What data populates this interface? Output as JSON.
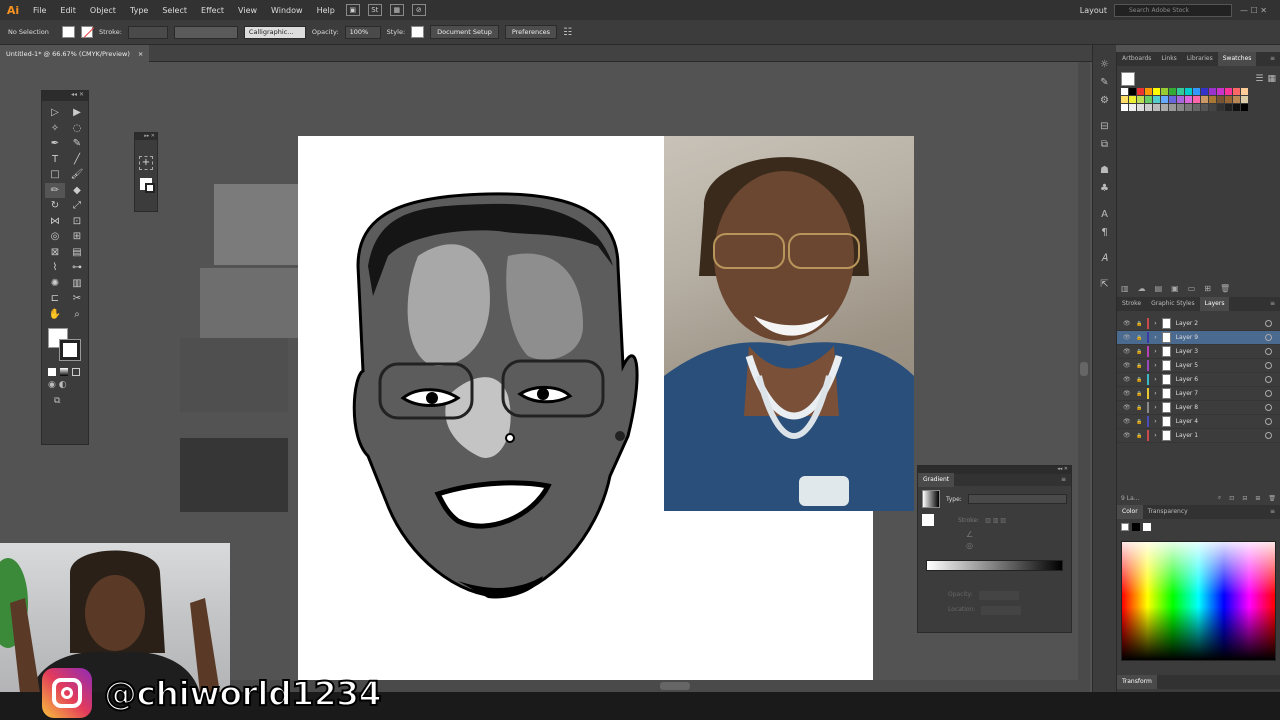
{
  "app": {
    "logo": "Ai"
  },
  "menu": [
    "File",
    "Edit",
    "Object",
    "Type",
    "Select",
    "Effect",
    "View",
    "Window",
    "Help"
  ],
  "menu_right": {
    "workspace": "Layout",
    "search_placeholder": "Search Adobe Stock"
  },
  "control_bar": {
    "selection": "No Selection",
    "stroke_label": "Stroke:",
    "brush": "Calligraphic...",
    "opacity_label": "Opacity:",
    "opacity_value": "100%",
    "style_label": "Style:",
    "document_setup": "Document Setup",
    "preferences": "Preferences"
  },
  "document_tab": {
    "title": "Untitled-1* @ 66.67% (CMYK/Preview)",
    "close": "×"
  },
  "right_panel_tabs_top": [
    "Artboards",
    "Links",
    "Libraries",
    "Swatches"
  ],
  "layers_tabs": [
    "Stroke",
    "Graphic Styles",
    "Layers"
  ],
  "layers": [
    {
      "name": "Layer 2",
      "color": "#c84a4a"
    },
    {
      "name": "Layer 9",
      "color": "#3a3aa8",
      "selected": true
    },
    {
      "name": "Layer 3",
      "color": "#b840b8"
    },
    {
      "name": "Layer 5",
      "color": "#9a4ab8"
    },
    {
      "name": "Layer 6",
      "color": "#3ab8c8"
    },
    {
      "name": "Layer 7",
      "color": "#e8c830"
    },
    {
      "name": "Layer 8",
      "color": "#8a8a8a"
    },
    {
      "name": "Layer 4",
      "color": "#4a4ab8"
    },
    {
      "name": "Layer 1",
      "color": "#c84a4a"
    }
  ],
  "layers_footer": "9 La...",
  "color_tabs": [
    "Color",
    "Transparency"
  ],
  "transform_tab": "Transform",
  "gradient_panel": {
    "title": "Gradient",
    "type_label": "Type:",
    "stroke_label": "Stroke:",
    "opacity_label": "Opacity:",
    "location_label": "Location:"
  },
  "watermark": {
    "handle": "@chiworld1234"
  },
  "colors": {
    "accent_orange": "#f7931e",
    "layer_selected": "#4a6a8f",
    "canvas_bg": "#535353"
  }
}
